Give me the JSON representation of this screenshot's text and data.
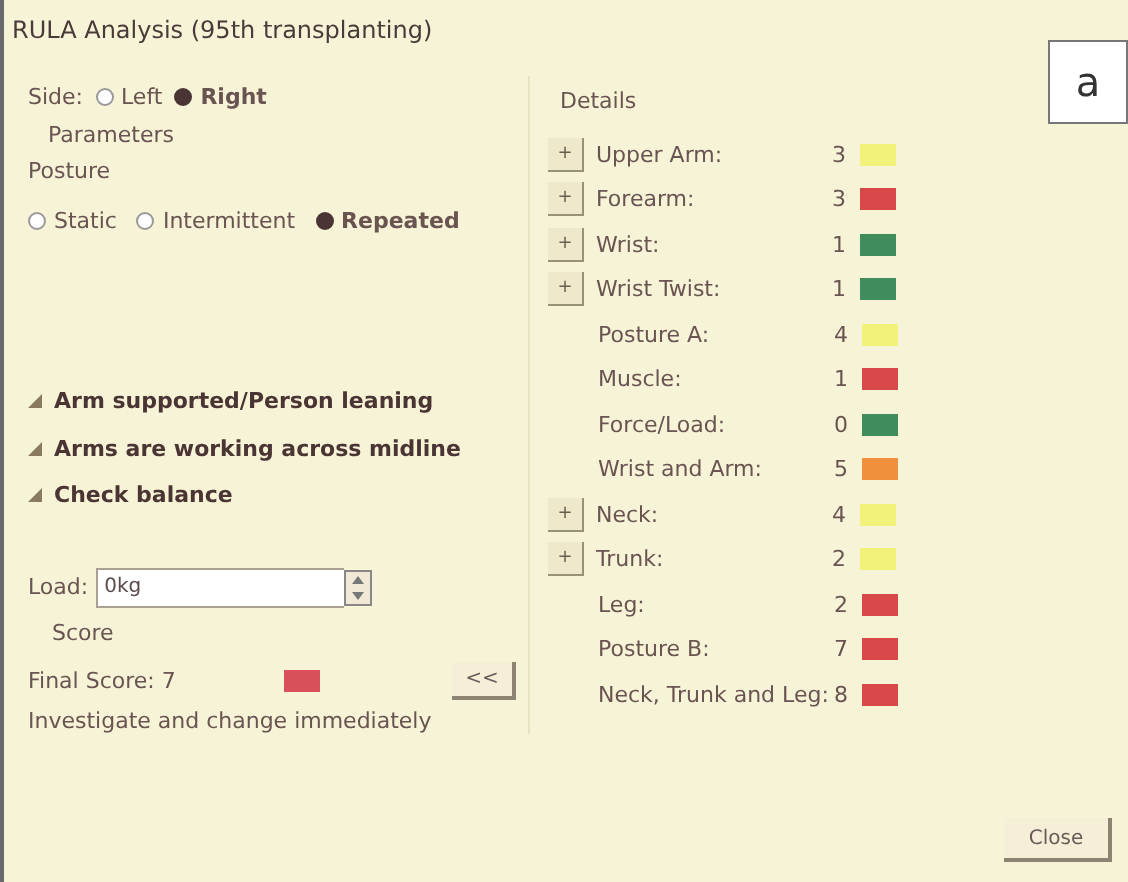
{
  "window": {
    "title": "RULA Analysis (95th transplanting)"
  },
  "panel_label": "a",
  "side": {
    "label": "Side:",
    "options": [
      {
        "label": "Left",
        "selected": false
      },
      {
        "label": "Right",
        "selected": true
      }
    ]
  },
  "parameters": {
    "heading": "Parameters",
    "posture": {
      "label": "Posture",
      "options": [
        {
          "label": "Static",
          "selected": false
        },
        {
          "label": "Intermittent",
          "selected": false
        },
        {
          "label": "Repeated",
          "selected": true
        }
      ]
    },
    "options": [
      "Arm supported/Person leaning",
      "Arms are working across midline",
      "Check balance"
    ],
    "load": {
      "label": "Load:",
      "value": "0kg"
    }
  },
  "score": {
    "heading": "Score",
    "final": "Final Score: 7",
    "color": "#d9505a",
    "advice": "Investigate and change immediately",
    "collapse_button": "<<"
  },
  "details": {
    "heading": "Details",
    "rows": [
      {
        "button": "+",
        "label": "Upper Arm:",
        "value": "3",
        "color": "#f2f27a"
      },
      {
        "button": "+",
        "label": "Forearm:",
        "value": "3",
        "color": "#d84848"
      },
      {
        "button": "+",
        "label": "Wrist:",
        "value": "1",
        "color": "#3f8c5c"
      },
      {
        "button": "+",
        "label": "Wrist Twist:",
        "value": "1",
        "color": "#3f8c5c"
      },
      {
        "label": "Posture A:",
        "value": "4",
        "color": "#f2f27a"
      },
      {
        "label": "Muscle:",
        "value": "1",
        "color": "#d84848"
      },
      {
        "label": "Force/Load:",
        "value": "0",
        "color": "#3f8c5c"
      },
      {
        "label": "Wrist and Arm:",
        "value": "5",
        "color": "#f0903c"
      },
      {
        "button": "+",
        "label": "Neck:",
        "value": "4",
        "color": "#f2f27a"
      },
      {
        "button": "+",
        "label": "Trunk:",
        "value": "2",
        "color": "#f2f27a"
      },
      {
        "label": "Leg:",
        "value": "2",
        "color": "#d84848"
      },
      {
        "label": "Posture B:",
        "value": "7",
        "color": "#d84848"
      },
      {
        "label": "Neck, Trunk and Leg:",
        "value": "8",
        "color": "#d84848"
      }
    ]
  },
  "buttons": [
    "Close"
  ]
}
